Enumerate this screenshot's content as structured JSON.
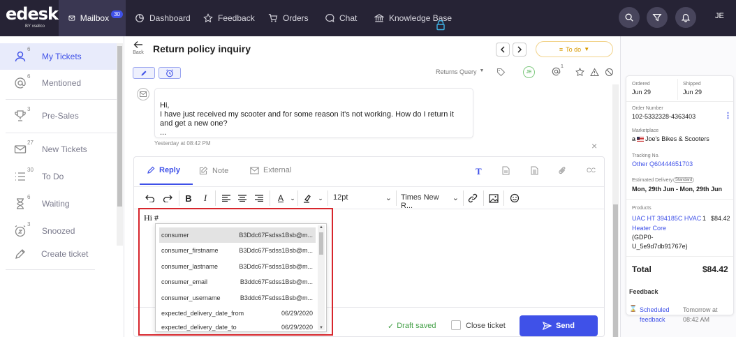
{
  "nav": {
    "brand": "edesk",
    "brand_sub": "BY xsellco",
    "items": [
      {
        "label": "Mailbox",
        "badge": "30"
      },
      {
        "label": "Dashboard"
      },
      {
        "label": "Feedback"
      },
      {
        "label": "Orders"
      },
      {
        "label": "Chat"
      },
      {
        "label": "Knowledge Base"
      }
    ],
    "user_initials": "JE"
  },
  "sidebar": {
    "items": [
      {
        "label": "My Tickets",
        "count": "6"
      },
      {
        "label": "Mentioned",
        "count": "6"
      },
      {
        "label": "Pre-Sales",
        "count": "3"
      },
      {
        "label": "New Tickets",
        "count": "27"
      },
      {
        "label": "To Do",
        "count": "30"
      },
      {
        "label": "Waiting",
        "count": "6"
      },
      {
        "label": "Snoozed",
        "count": "3"
      },
      {
        "label": "Create ticket",
        "count": ""
      }
    ]
  },
  "header": {
    "back_label": "Back",
    "title": "Return policy inquiry",
    "status": "To do",
    "query_type": "Returns Query",
    "assignee": "JE",
    "mention_count": "1"
  },
  "message": {
    "lines": [
      "Hi,",
      "I have just received my scooter and for some reason it's not working. How do I return it and get a new one?",
      "..."
    ],
    "timestamp": "Yesterday at 08:42 PM"
  },
  "reply": {
    "tabs": [
      "Reply",
      "Note",
      "External"
    ],
    "cc": "CC",
    "font_size": "12pt",
    "font_family": "Times New R...",
    "content": "Hi #",
    "autocomplete": [
      {
        "key": "consumer",
        "value": "B3Ddc67Fsdss1Bsb@m..."
      },
      {
        "key": "consumer_firstname",
        "value": "B3Ddc67Fsdss1Bsb@m..."
      },
      {
        "key": "consumer_lastname",
        "value": "B3Ddc67Fsdss1Bsb@m..."
      },
      {
        "key": "consumer_email",
        "value": "B3ddc67Fsdss1Bsb@m..."
      },
      {
        "key": "consumer_username",
        "value": "B3ddc67Fsdss1Bsb@m..."
      },
      {
        "key": "expected_delivery_date_from",
        "value": "06/29/2020"
      },
      {
        "key": "expected_delivery_date_to",
        "value": "06/29/2020"
      }
    ],
    "draft_status": "Draft saved",
    "close_ticket": "Close ticket",
    "send": "Send"
  },
  "order": {
    "ordered_label": "Ordered",
    "ordered": "Jun 29",
    "shipped_label": "Shipped",
    "shipped": "Jun 29",
    "order_number_label": "Order Number",
    "order_number": "102-5332328-4363403",
    "marketplace_label": "Marketplace",
    "marketplace": "Joe's Bikes & Scooters",
    "tracking_label": "Tracking No.",
    "tracking": "Other Q60444651703",
    "delivery_label": "Estimated Delivery",
    "delivery_tag": "Standard",
    "delivery": "Mon, 29th Jun - Mon, 29th Jun",
    "products_label": "Products",
    "product_name_1": "UAC HT 394185C HVAC",
    "product_name_2": "Heater Core",
    "product_qty": "1",
    "product_price": "$84.42",
    "product_sku_1": "(GDP0-",
    "product_sku_2": "U_5e9d7db91767e)",
    "total_label": "Total",
    "total": "$84.42"
  },
  "feedback": {
    "heading": "Feedback",
    "item_1": "Scheduled",
    "item_2": "feedback",
    "when_1": "Tomorrow at",
    "when_2": "08:42 AM"
  },
  "colors": {
    "nav_bg": "#262335",
    "accent": "#3f51e8",
    "highlight": "#d7262c",
    "draft": "#43a047"
  }
}
